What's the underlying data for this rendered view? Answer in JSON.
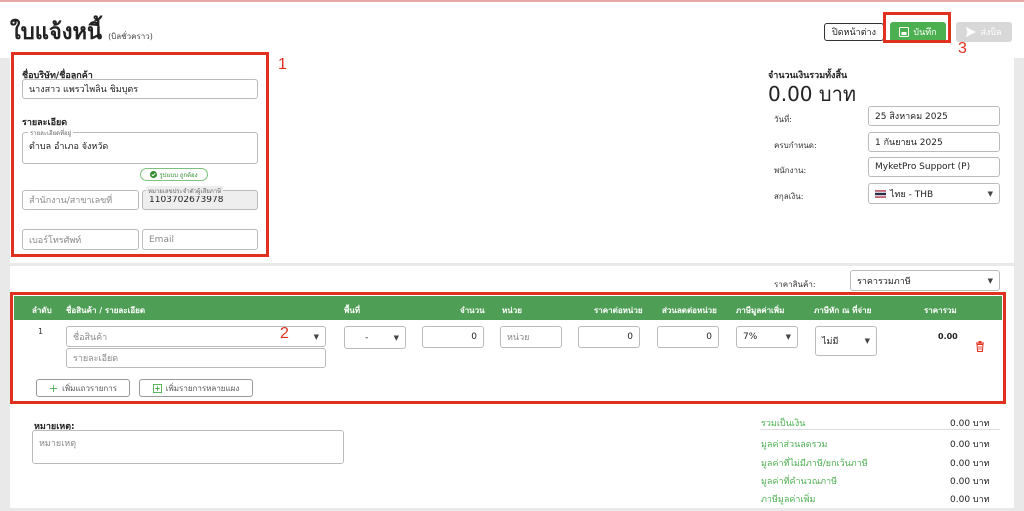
{
  "header": {
    "title": "ใบแจ้งหนี้",
    "subtitle": "(บิลชั่วคราว)",
    "close_label": "ปิดหน้าต่าง",
    "save_label": "บันทึก",
    "send_label": "ส่งบิล"
  },
  "annotations": {
    "one": "1",
    "two": "2",
    "three": "3"
  },
  "customer": {
    "name_label": "ชื่อบริษัท/ชื่อลูกค้า",
    "name_value": "นางสาว แพรวไพลิน ชิมบุตร",
    "details_label": "รายละเอียด",
    "address_label": "รายละเอียดที่อยู่",
    "address_value": "ตำบล อำเภอ จังหวัด",
    "valid_badge": "รูปแบบ ถูกต้อง",
    "branch_placeholder": "สำนักงาน/สาขาเลขที่",
    "tax_label": "หมายเลขประจำตัวผู้เสียภาษี",
    "tax_value": "1103702673978",
    "phone_placeholder": "เบอร์โทรศัพท์",
    "email_placeholder": "Email"
  },
  "summary": {
    "total_label": "จำนวนเงินรวมทั้งสิ้น",
    "total_value": "0.00 บาท",
    "date_label": "วันที่:",
    "date_value": "25 สิงหาคม 2025",
    "due_label": "ครบกำหนด:",
    "due_value": "1 กันยายน 2025",
    "staff_label": "พนักงาน:",
    "staff_value": "MyketPro Support (P)",
    "currency_label": "สกุลเงิน:",
    "currency_value": "ไทย - THB",
    "price_type_label": "ราคาสินค้า:",
    "price_type_value": "ราคารวมภาษี"
  },
  "table": {
    "headers": [
      "ลำดับ",
      "ชื่อสินค้า / รายละเอียด",
      "พื้นที่",
      "จำนวน",
      "หน่วย",
      "ราคาต่อหน่วย",
      "ส่วนลดต่อหน่วย",
      "ภาษีมูลค่าเพิ่ม",
      "ภาษีหัก ณ ที่จ่าย",
      "ราคารวม"
    ],
    "row": {
      "index": "1",
      "product_placeholder": "ชื่อสินค้า",
      "detail_placeholder": "รายละเอียด",
      "area_value": "-",
      "qty_value": "0",
      "unit_placeholder": "หน่วย",
      "price_value": "0",
      "discount_value": "0",
      "vat_value": "7%",
      "wht_value": "ไม่มี",
      "total_value": "0.00"
    },
    "add_row_label": "เพิ่มแถวรายการ",
    "add_multi_label": "เพิ่มรายการหลายแผง"
  },
  "notes": {
    "label": "หมายเหตุ:",
    "placeholder": "หมายเหตุ"
  },
  "totals": [
    {
      "label": "รวมเป็นเงิน",
      "value": "0.00 บาท"
    },
    {
      "label": "มูลค่าส่วนลดรวม",
      "value": "0.00 บาท"
    },
    {
      "label": "มูลค่าที่ไม่มีภาษี/ยกเว้นภาษี",
      "value": "0.00 บาท"
    },
    {
      "label": "มูลค่าที่คำนวณภาษี",
      "value": "0.00 บาท"
    },
    {
      "label": "ภาษีมูลค่าเพิ่ม",
      "value": "0.00 บาท"
    }
  ],
  "colors": {
    "accent": "#4caf50",
    "annotation": "#e0301e",
    "table_header": "#4f9e55"
  }
}
